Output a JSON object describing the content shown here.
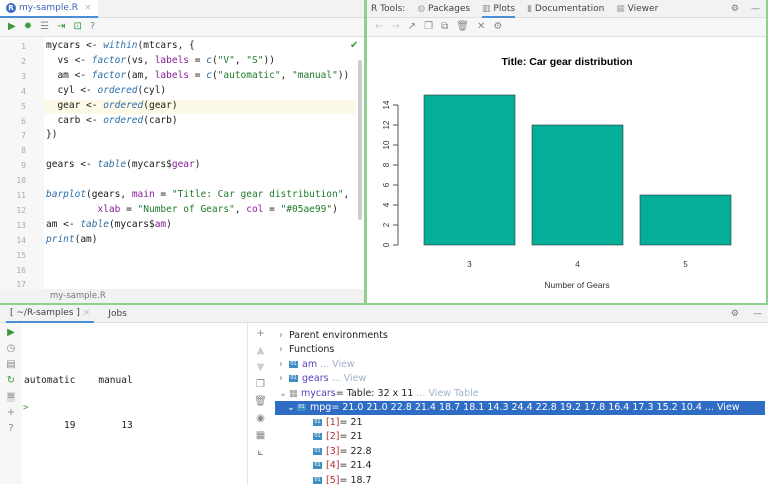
{
  "editor": {
    "tab": "my-sample.R",
    "breadcrumb": "my-sample.R",
    "lines": [
      [
        [
          "mycars <- ",
          ""
        ],
        [
          "within",
          "fn"
        ],
        [
          "(mtcars, {",
          ""
        ]
      ],
      [
        [
          "  vs <- ",
          ""
        ],
        [
          "factor",
          "fn"
        ],
        [
          "(vs, ",
          ""
        ],
        [
          "labels",
          "arg"
        ],
        [
          " = ",
          ""
        ],
        [
          "c",
          "fn"
        ],
        [
          "(",
          ""
        ],
        [
          "\"V\"",
          "str"
        ],
        [
          ", ",
          ""
        ],
        [
          "\"S\"",
          "str"
        ],
        [
          "))",
          ""
        ]
      ],
      [
        [
          "  am <- ",
          ""
        ],
        [
          "factor",
          "fn"
        ],
        [
          "(am, ",
          ""
        ],
        [
          "labels",
          "arg"
        ],
        [
          " = ",
          ""
        ],
        [
          "c",
          "fn"
        ],
        [
          "(",
          ""
        ],
        [
          "\"automatic\"",
          "str"
        ],
        [
          ", ",
          ""
        ],
        [
          "\"manual\"",
          "str"
        ],
        [
          "))",
          ""
        ]
      ],
      [
        [
          "  cyl <- ",
          ""
        ],
        [
          "ordered",
          "fn"
        ],
        [
          "(cyl)",
          ""
        ]
      ],
      [
        [
          "  gear <- ",
          ""
        ],
        [
          "ordered",
          "fn"
        ],
        [
          "(gear)",
          ""
        ]
      ],
      [
        [
          "  carb <- ",
          ""
        ],
        [
          "ordered",
          "fn"
        ],
        [
          "(carb)",
          ""
        ]
      ],
      [
        [
          "})",
          ""
        ]
      ],
      [],
      [
        [
          "gears <- ",
          ""
        ],
        [
          "table",
          "fn"
        ],
        [
          "(mycars$",
          ""
        ],
        [
          "gear",
          "arg"
        ],
        [
          ")",
          ""
        ]
      ],
      [],
      [
        [
          "barplot",
          "fn"
        ],
        [
          "(gears, ",
          ""
        ],
        [
          "main",
          "arg"
        ],
        [
          " = ",
          ""
        ],
        [
          "\"Title: Car gear distribution\"",
          "str"
        ],
        [
          ",",
          ""
        ]
      ],
      [
        [
          "         ",
          ""
        ],
        [
          "xlab",
          "arg"
        ],
        [
          " = ",
          ""
        ],
        [
          "\"Number of Gears\"",
          "str"
        ],
        [
          ", ",
          ""
        ],
        [
          "col",
          "arg"
        ],
        [
          " = ",
          ""
        ],
        [
          "\"#05ae99\"",
          "str"
        ],
        [
          ")",
          ""
        ]
      ],
      [
        [
          "am <- ",
          ""
        ],
        [
          "table",
          "fn"
        ],
        [
          "(mycars$",
          ""
        ],
        [
          "am",
          "arg"
        ],
        [
          ")",
          ""
        ]
      ],
      [
        [
          "print",
          "fn"
        ],
        [
          "(am)",
          ""
        ]
      ],
      [],
      [],
      []
    ]
  },
  "plots": {
    "label": "R Tools:",
    "tabs": [
      "Packages",
      "Plots",
      "Documentation",
      "Viewer"
    ],
    "active": "Plots"
  },
  "chart_data": {
    "type": "bar",
    "title": "Title: Car gear distribution",
    "xlabel": "Number of Gears",
    "ylabel": "",
    "categories": [
      "3",
      "4",
      "5"
    ],
    "values": [
      15,
      12,
      5
    ],
    "ylim": [
      0,
      15
    ],
    "yticks": [
      "0",
      "2",
      "4",
      "6",
      "8",
      "10",
      "12",
      "14"
    ],
    "color": "#05ae99",
    "grid": false
  },
  "console": {
    "tabs": [
      "[ ~/R-samples ]",
      "Jobs"
    ],
    "output": [
      "automatic    manual",
      "       19        13"
    ],
    "prompt": ">"
  },
  "variables": {
    "rows": [
      {
        "label": "Parent environments",
        "type": "group",
        "open": false
      },
      {
        "label": "Functions",
        "type": "group",
        "open": false
      },
      {
        "name": "am",
        "value": "",
        "view": "... View",
        "type": "vec",
        "open": false
      },
      {
        "name": "gears",
        "value": "",
        "view": "... View",
        "type": "vec",
        "open": false
      },
      {
        "name": "mycars",
        "value": " = Table: 32 x 11",
        "view": "... View Table",
        "type": "table",
        "open": true
      },
      {
        "name": "mpg",
        "value": " = 21.0 21.0 22.8 21.4 18.7 18.1 14.3 24.4 22.8 19.2 17.8 16.4 17.3 15.2 10.4",
        "view": "... View",
        "type": "vec",
        "open": true,
        "selected": true
      },
      {
        "name": "[1]",
        "value": " = 21",
        "type": "item"
      },
      {
        "name": "[2]",
        "value": " = 21",
        "type": "item"
      },
      {
        "name": "[3]",
        "value": " = 22.8",
        "type": "item"
      },
      {
        "name": "[4]",
        "value": " = 21.4",
        "type": "item"
      },
      {
        "name": "[5]",
        "value": " = 18.7",
        "type": "item"
      }
    ]
  }
}
